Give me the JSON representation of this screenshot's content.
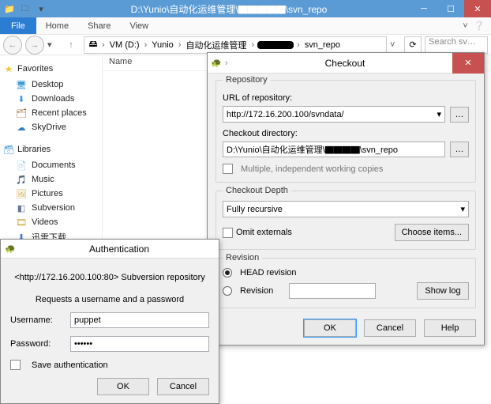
{
  "window": {
    "title": "D:\\Yunio\\自动化运维管理\\▇▇▇▇▇\\svn_repo"
  },
  "ribbon": {
    "file": "File",
    "home": "Home",
    "share": "Share",
    "view": "View"
  },
  "address": {
    "nav_up_tooltip": "Up",
    "crumbs": [
      "VM (D:)",
      "Yunio",
      "自动化运维管理",
      "▇▇▇▇",
      "svn_repo"
    ],
    "search_placeholder": "Search sv…"
  },
  "sidebar": {
    "favorites": {
      "label": "Favorites",
      "items": [
        "Desktop",
        "Downloads",
        "Recent places",
        "SkyDrive"
      ]
    },
    "libraries": {
      "label": "Libraries",
      "items": [
        "Documents",
        "Music",
        "Pictures",
        "Subversion",
        "Videos",
        "迅雷下载"
      ]
    }
  },
  "column_header": "Name",
  "checkout": {
    "title": "Checkout",
    "repo_group": "Repository",
    "url_label": "URL of repository:",
    "url_value": "http://172.16.200.100/svndata/",
    "dir_label": "Checkout directory:",
    "dir_value": "D:\\Yunio\\自动化运维管理\\▇▇▇▇\\svn_repo",
    "multi_label": "Multiple, independent working copies",
    "depth_group": "Checkout Depth",
    "depth_value": "Fully recursive",
    "omit_label": "Omit externals",
    "choose_label": "Choose items...",
    "rev_group": "Revision",
    "head_label": "HEAD revision",
    "rev_label": "Revision",
    "rev_value": "",
    "showlog": "Show log",
    "ok": "OK",
    "cancel": "Cancel",
    "help": "Help"
  },
  "auth": {
    "title": "Authentication",
    "repo_line": "<http://172.16.200.100:80> Subversion repository",
    "prompt": "Requests a username and a password",
    "username_label": "Username:",
    "username_value": "puppet",
    "password_label": "Password:",
    "password_value": "••••••",
    "save_label": "Save authentication",
    "ok": "OK",
    "cancel": "Cancel"
  }
}
